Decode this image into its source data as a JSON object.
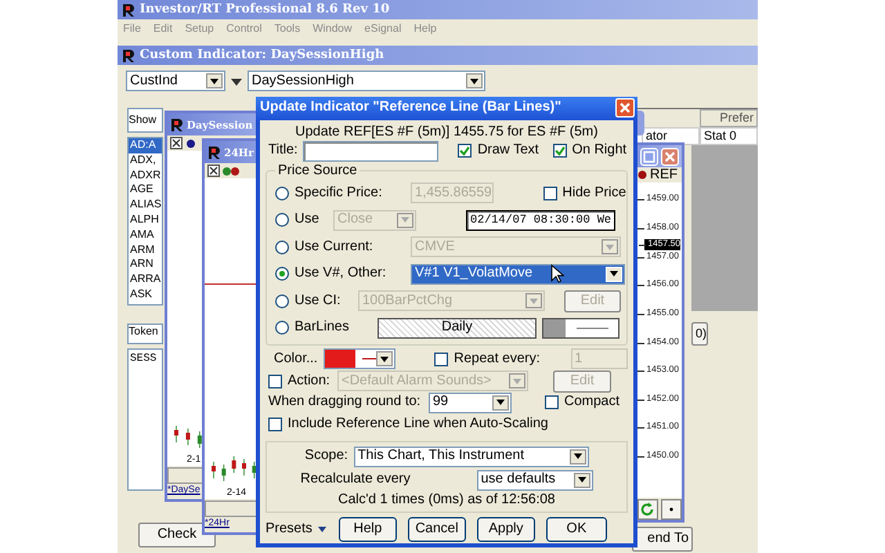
{
  "app": {
    "title": "Investor/RT Professional 8.6 Rev 10",
    "menu": [
      "File",
      "Edit",
      "Setup",
      "Control",
      "Tools",
      "Window",
      "eSignal",
      "Help"
    ]
  },
  "custom_indicator": {
    "title": "Custom Indicator:  DaySessionHigh",
    "type_combo": "CustInd",
    "name_combo": "DaySessionHigh",
    "list_header": "Show",
    "symbols": [
      {
        "label": "AD:A",
        "selected": true
      },
      {
        "label": "ADX,",
        "selected": false
      },
      {
        "label": "ADXR",
        "selected": false
      },
      {
        "label": "AGE",
        "selected": false
      },
      {
        "label": "ALIAS",
        "selected": false
      },
      {
        "label": "ALPH",
        "selected": false
      },
      {
        "label": "AMA",
        "selected": false
      },
      {
        "label": "ARM",
        "selected": false
      },
      {
        "label": "ARN",
        "selected": false
      },
      {
        "label": "ARRA",
        "selected": false
      },
      {
        "label": "ASK",
        "selected": false
      }
    ],
    "token_label": "Token",
    "text_area": "SESS",
    "column_header": "Prefer",
    "row_cells": [
      "ator",
      "Stat 0"
    ],
    "side_button": "0)",
    "check_button": "Check",
    "send_button": "end To"
  },
  "day_session_window": {
    "title": "DaySession",
    "date_label": "2-1",
    "tab": "*DaySe"
  },
  "window_24hr": {
    "title": "24Hr",
    "date_label": "2-14",
    "tab": "*24Hr"
  },
  "chart_window": {
    "header": "REF",
    "prices": [
      "1459.00",
      "1458.00",
      "1457.00",
      "1456.00",
      "1455.00",
      "1454.00",
      "1453.00",
      "1452.00",
      "1451.00",
      "1450.00"
    ],
    "current_price": "1457.50"
  },
  "dialog": {
    "title": "Update Indicator \"Reference Line (Bar Lines)\"",
    "heading": "Update REF[ES #F (5m)] 1455.75 for ES #F (5m)",
    "title_label": "Title:",
    "options": [
      {
        "label": "Draw Text",
        "checked": true
      },
      {
        "label": "On Right",
        "checked": true
      }
    ],
    "price_source": {
      "legend": "Price Source",
      "sources": [
        {
          "kind": "specific",
          "label": "Specific Price:",
          "selected": false,
          "value": "1,455.86559",
          "disabled": true,
          "check_label": "Hide Price",
          "checked": false
        },
        {
          "kind": "use",
          "label": "Use",
          "selected": false,
          "combo": "Close",
          "disabled": true,
          "datetime": "02/14/07 08:30:00 We"
        },
        {
          "kind": "combo",
          "label": "Use Current:",
          "selected": false,
          "combo": "CMVE",
          "disabled": true
        },
        {
          "kind": "combo",
          "label": "Use V#, Other:",
          "selected": true,
          "combo": "V#1  V1_VolatMove",
          "disabled": false
        },
        {
          "kind": "ci",
          "label": "Use CI:",
          "selected": false,
          "combo": "100BarPctChg",
          "disabled": true,
          "button": "Edit"
        },
        {
          "kind": "barlines",
          "label": "BarLines",
          "selected": false,
          "pattern": "Daily"
        }
      ]
    },
    "color": {
      "label": "Color...",
      "color": "#e31b1b"
    },
    "repeat": {
      "label": "Repeat every:",
      "checked": false,
      "value": "1"
    },
    "action": {
      "label": "Action:",
      "checked": false,
      "combo": "<Default Alarm Sounds>",
      "button": "Edit"
    },
    "rounding": {
      "label": "When dragging round to:",
      "combo": "99"
    },
    "compact": {
      "label": "Compact",
      "checked": false
    },
    "autoscale": {
      "label": "Include Reference Line when Auto-Scaling",
      "checked": false
    },
    "scope": {
      "label": "Scope:",
      "combo": "This Chart, This Instrument"
    },
    "recalc": {
      "label": "Recalculate every",
      "combo": "use defaults"
    },
    "status": "Calc'd 1 times (0ms) as of 12:56:08",
    "presets": "Presets",
    "buttons": [
      "Help",
      "Cancel",
      "Apply",
      "OK"
    ]
  }
}
